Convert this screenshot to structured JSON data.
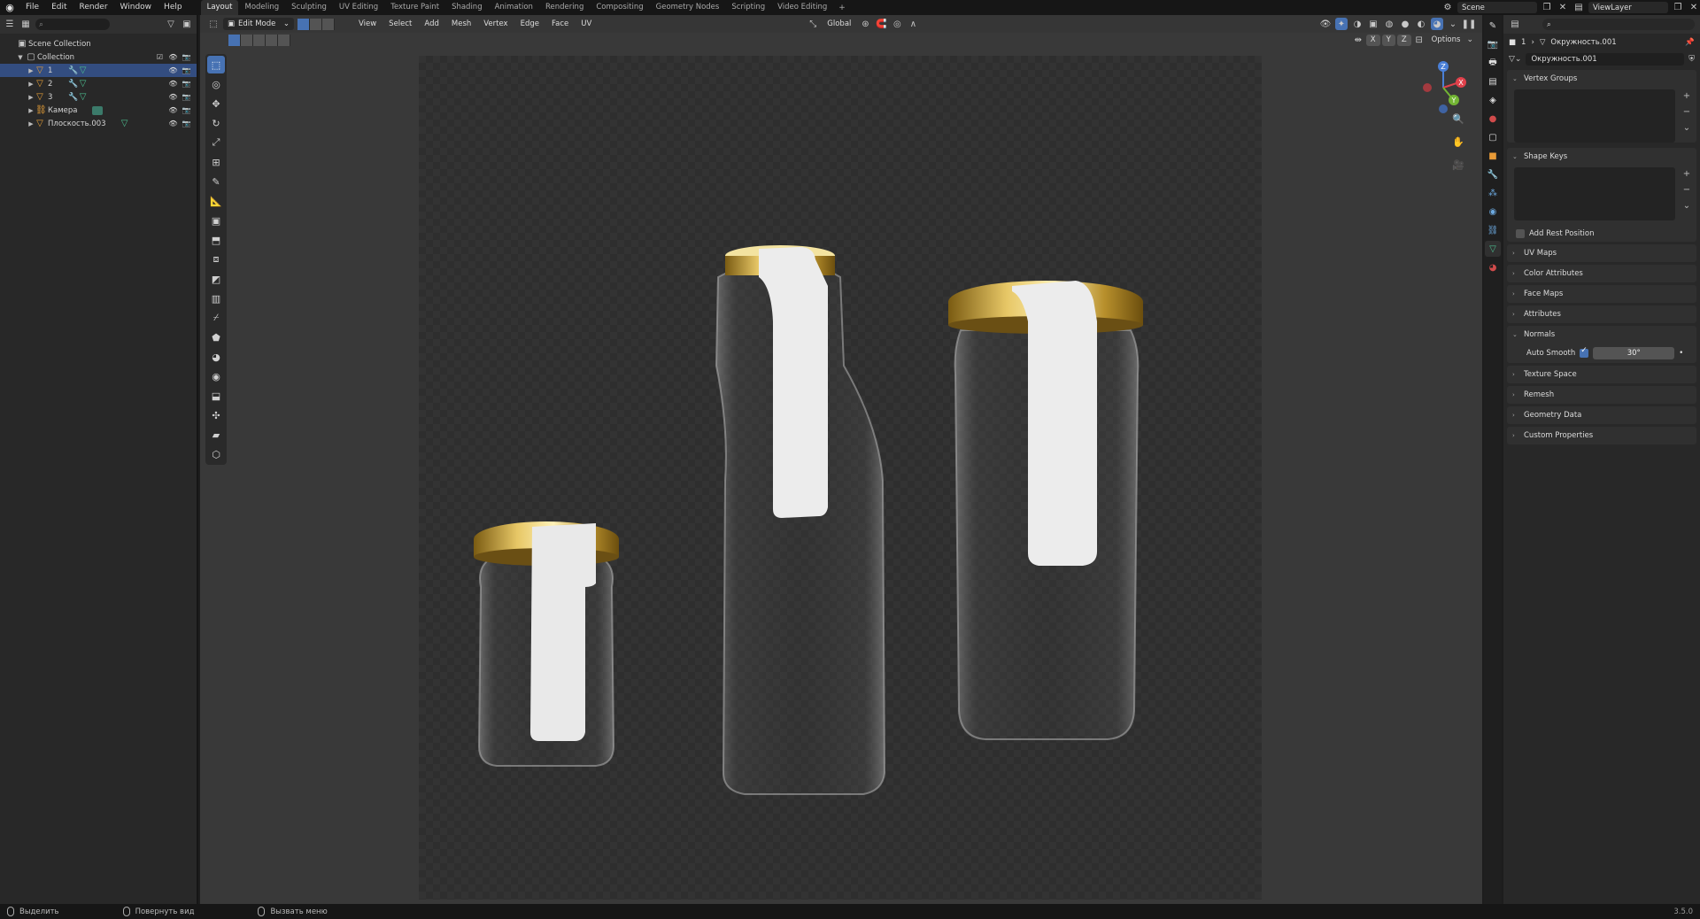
{
  "topbar": {
    "menus": [
      "File",
      "Edit",
      "Render",
      "Window",
      "Help"
    ],
    "workspaces": [
      "Layout",
      "Modeling",
      "Sculpting",
      "UV Editing",
      "Texture Paint",
      "Shading",
      "Animation",
      "Rendering",
      "Compositing",
      "Geometry Nodes",
      "Scripting",
      "Video Editing"
    ],
    "active_workspace": "Layout",
    "scene": "Scene",
    "view_layer": "ViewLayer"
  },
  "outliner": {
    "scene_collection": "Scene Collection",
    "collection": "Collection",
    "items": [
      {
        "label": "1",
        "selected": true
      },
      {
        "label": "2",
        "selected": false
      },
      {
        "label": "3",
        "selected": false
      },
      {
        "label": "Камера",
        "selected": false
      },
      {
        "label": "Плоскость.003",
        "selected": false
      }
    ]
  },
  "viewport": {
    "mode": "Edit Mode",
    "menus": [
      "View",
      "Select",
      "Add",
      "Mesh",
      "Vertex",
      "Edge",
      "Face",
      "UV"
    ],
    "orientation": "Global",
    "options": "Options",
    "axes": [
      "X",
      "Y",
      "Z"
    ]
  },
  "properties": {
    "crumb_obj": "1",
    "crumb_mesh": "Окружность.001",
    "mesh_name": "Окружность.001",
    "panels": {
      "vertex_groups": "Vertex Groups",
      "shape_keys": "Shape Keys",
      "add_rest_position": "Add Rest Position",
      "uv_maps": "UV Maps",
      "color_attributes": "Color Attributes",
      "face_maps": "Face Maps",
      "attributes": "Attributes",
      "normals": "Normals",
      "auto_smooth": "Auto Smooth",
      "auto_smooth_angle": "30°",
      "texture_space": "Texture Space",
      "remesh": "Remesh",
      "geometry_data": "Geometry Data",
      "custom_properties": "Custom Properties"
    }
  },
  "statusbar": {
    "select": "Выделить",
    "rotate": "Повернуть вид",
    "menu": "Вызвать меню",
    "version": "3.5.0"
  }
}
